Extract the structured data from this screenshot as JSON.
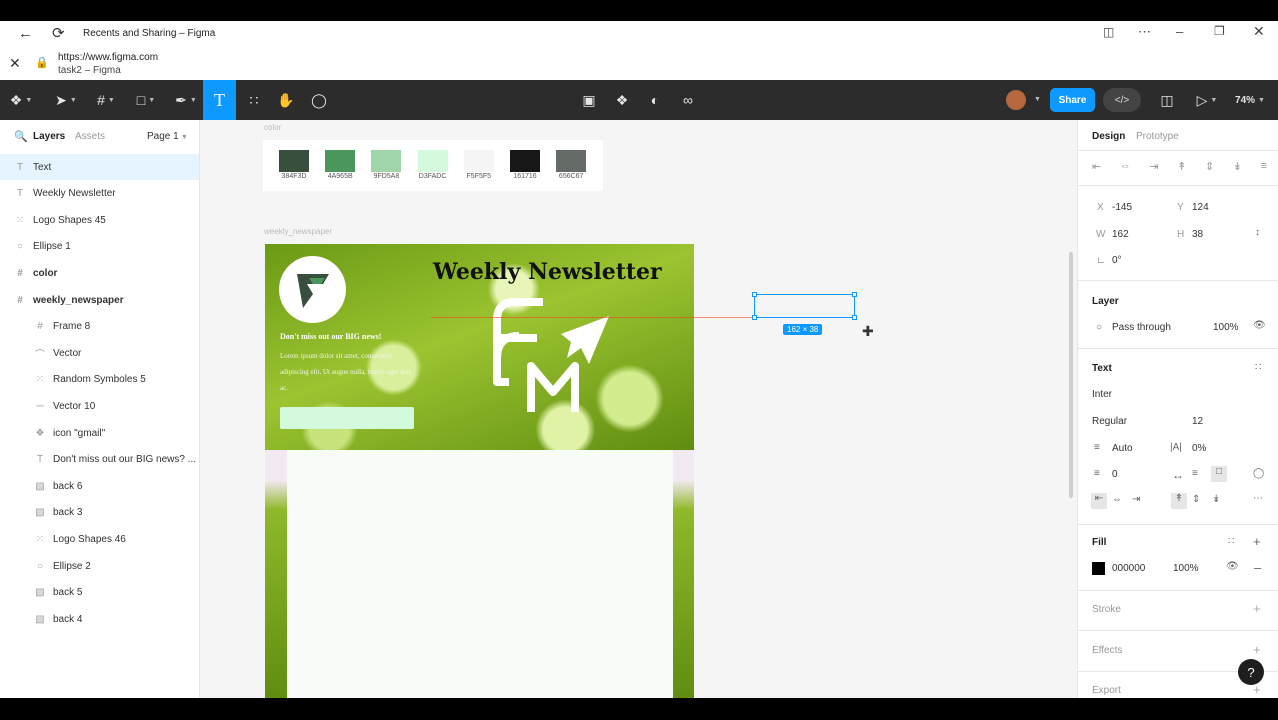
{
  "browser": {
    "tab_title": "Recents and Sharing – Figma",
    "url": "https://www.figma.com",
    "page_title": "task2 – Figma"
  },
  "toolbar": {
    "share_label": "Share",
    "zoom": "74%"
  },
  "left_panel": {
    "tabs": [
      "Layers",
      "Assets"
    ],
    "page": "Page 1",
    "layers": [
      {
        "label": "Text",
        "icon": "text-icon"
      },
      {
        "label": "Weekly Newsletter",
        "icon": "text-icon"
      },
      {
        "label": "Logo Shapes 45",
        "icon": "group-icon"
      },
      {
        "label": "Ellipse 1",
        "icon": "ellipse-icon"
      },
      {
        "label": "color",
        "icon": "frame-icon"
      },
      {
        "label": "weekly_newspaper",
        "icon": "frame-icon"
      },
      {
        "label": "Frame 8",
        "icon": "frame-icon"
      },
      {
        "label": "Vector",
        "icon": "vector-icon"
      },
      {
        "label": "Random Symboles 5",
        "icon": "group-icon"
      },
      {
        "label": "Vector 10",
        "icon": "line-icon"
      },
      {
        "label": "icon \"gmail\"",
        "icon": "component-icon"
      },
      {
        "label": "Don't miss out our BIG news? ...",
        "icon": "text-icon"
      },
      {
        "label": "back 6",
        "icon": "image-icon"
      },
      {
        "label": "back 3",
        "icon": "image-icon"
      },
      {
        "label": "Logo Shapes 46",
        "icon": "group-icon"
      },
      {
        "label": "Ellipse 2",
        "icon": "ellipse-icon"
      },
      {
        "label": "back 5",
        "icon": "image-icon"
      },
      {
        "label": "back 4",
        "icon": "image-icon"
      }
    ]
  },
  "canvas": {
    "color_frame_label": "color",
    "swatches": [
      {
        "hex": "#384F3D",
        "label": "384F3D"
      },
      {
        "hex": "#4A965B",
        "label": "4A965B"
      },
      {
        "hex": "#9FD5A8",
        "label": "9FD5A8"
      },
      {
        "hex": "#D3FADC",
        "label": "D3FADC"
      },
      {
        "hex": "#F5F5F5",
        "label": "F5F5F5"
      },
      {
        "hex": "#161716",
        "label": "161716"
      },
      {
        "hex": "#656C67",
        "label": "656C67"
      }
    ],
    "frame_label": "weekly_newspaper",
    "newsletter_title": "Weekly Newsletter",
    "headline": "Don't miss out our BIG news!",
    "body_text": "Lorem ipsum dolor sit amet, consectetur adipiscing elit. Ut augue nulla, mattis eget ante ac.",
    "selection_size": "162 × 38"
  },
  "right_panel": {
    "tabs": [
      "Design",
      "Prototype"
    ],
    "x_label": "X",
    "x_value": "-145",
    "y_label": "Y",
    "y_value": "124",
    "w_label": "W",
    "w_value": "162",
    "h_label": "H",
    "h_value": "38",
    "rotation": "0°",
    "layer_title": "Layer",
    "blend_mode": "Pass through",
    "layer_opacity": "100%",
    "text_title": "Text",
    "font_family": "Inter",
    "font_weight": "Regular",
    "font_size": "12",
    "line_height": "Auto",
    "letter_spacing": "0%",
    "paragraph_spacing": "0",
    "fill_title": "Fill",
    "fill_hex": "000000",
    "fill_opacity": "100%",
    "stroke_title": "Stroke",
    "effects_title": "Effects",
    "export_title": "Export"
  }
}
